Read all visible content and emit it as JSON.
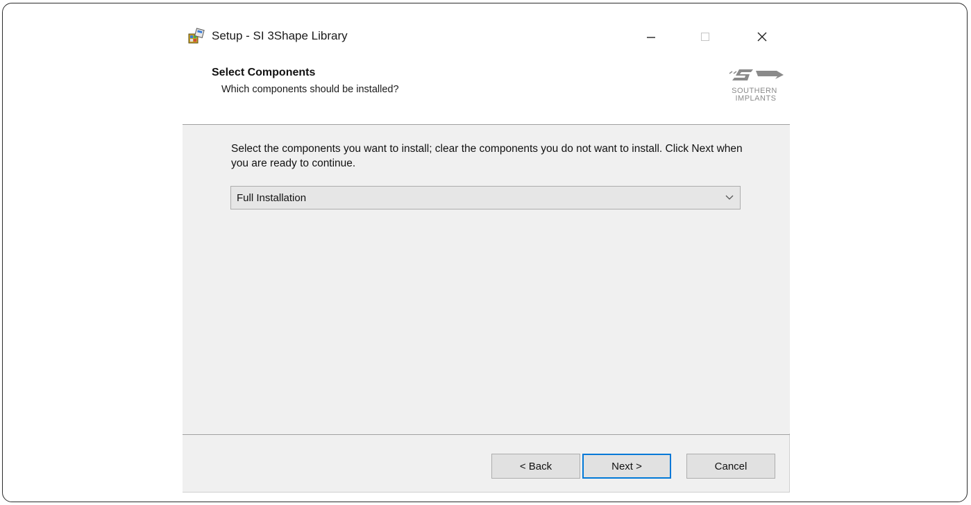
{
  "window": {
    "title": "Setup - SI 3Shape Library"
  },
  "header": {
    "title": "Select Components",
    "subtitle": "Which components should be installed?",
    "logo_lines": [
      "SOUTHERN",
      "IMPLANTS"
    ]
  },
  "main": {
    "instructions": "Select the components you want to install; clear the components you do not want to install. Click Next when you are ready to continue.",
    "installation_type": {
      "selected": "Full Installation"
    }
  },
  "buttons": {
    "back": "< Back",
    "next": "Next >",
    "cancel": "Cancel"
  },
  "icons": {
    "app": "setup-installer-icon",
    "minimize": "minimize-icon",
    "maximize": "maximize-icon",
    "close": "close-icon",
    "dropdown": "chevron-down-icon"
  },
  "colors": {
    "focus_border": "#0078d7",
    "dialog_background": "#f0f0f0",
    "header_background": "#ffffff"
  }
}
